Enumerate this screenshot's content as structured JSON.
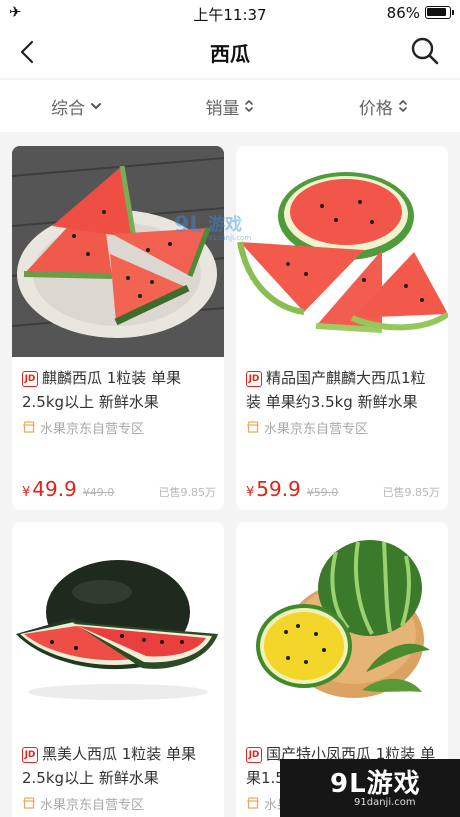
{
  "status_bar": {
    "time": "上午11:37",
    "battery": "86%"
  },
  "nav": {
    "title": "西瓜"
  },
  "filters": [
    {
      "label": "综合"
    },
    {
      "label": "销量"
    },
    {
      "label": "价格"
    }
  ],
  "products": [
    {
      "badge": "JD",
      "name": "麒麟西瓜 1粒装 单果2.5kg以上 新鲜水果",
      "store": "水果京东自营专区",
      "price_symbol": "¥",
      "price": "49.9",
      "old_price": "¥49.0",
      "sold": "已售9.85万"
    },
    {
      "badge": "JD",
      "name": "精品国产麒麟大西瓜1粒装 单果约3.5kg 新鲜水果",
      "store": "水果京东自营专区",
      "price_symbol": "¥",
      "price": "59.9",
      "old_price": "¥59.0",
      "sold": "已售9.85万"
    },
    {
      "badge": "JD",
      "name": "黑美人西瓜 1粒装 单果2.5kg以上 新鲜水果",
      "store": "水果京东自营专区"
    },
    {
      "badge": "JD",
      "name": "国产特小凤西瓜 1粒装 单果1.5kg",
      "store": "水果京东"
    }
  ],
  "watermark": {
    "mark": "9L",
    "text": "游戏",
    "domain": "91danji.com"
  },
  "brand_logo": {
    "main": "9L游戏",
    "sub": "91danji.com"
  }
}
